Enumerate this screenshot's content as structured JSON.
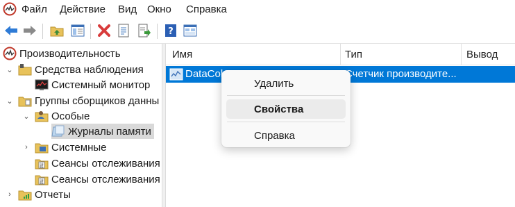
{
  "menu": {
    "items": [
      "Файл",
      "Действие",
      "Вид",
      "Окно",
      "Справка"
    ]
  },
  "toolbar": {
    "buttons": [
      "back-arrow-icon",
      "forward-arrow-icon",
      "up-folder-icon",
      "show-hide-tree-icon",
      "delete-icon",
      "properties-icon",
      "export-icon",
      "help-icon",
      "console-view-icon"
    ]
  },
  "tree": {
    "root": "Производительность",
    "monitoring_tools": "Средства наблюдения",
    "system_monitor": "Системный монитор",
    "collector_sets": "Группы сборщиков данны",
    "user_defined": "Особые",
    "memory_logs": "Журналы памяти",
    "system": "Системные",
    "trace_sessions": "Сеансы отслеживания",
    "trace_sessions_2": "Сеансы отслеживания",
    "reports": "Отчеты"
  },
  "list": {
    "columns": [
      "Имя",
      "Тип",
      "Вывод"
    ],
    "rows": [
      {
        "name": "DataCol",
        "type": "Счетчик производите..."
      }
    ]
  },
  "context_menu": {
    "items": [
      "Удалить",
      "Свойства",
      "Справка"
    ],
    "highlighted": "Свойства"
  },
  "colors": {
    "selection": "#0078d7",
    "accent_red": "#d83b3b"
  }
}
